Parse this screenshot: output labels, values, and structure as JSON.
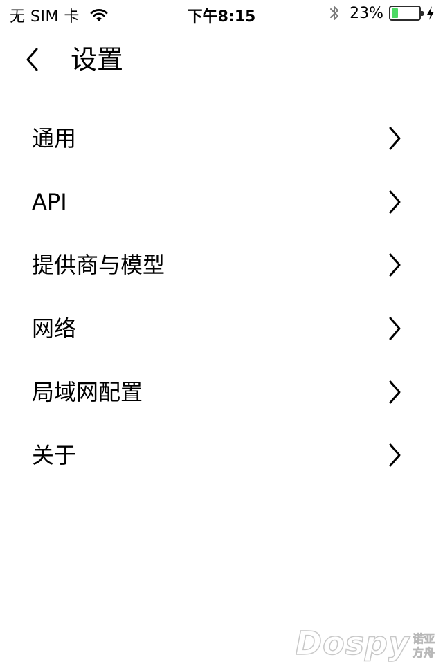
{
  "status_bar": {
    "carrier": "无 SIM 卡",
    "time": "下午8:15",
    "battery_percent": "23%",
    "battery_level": 0.23,
    "battery_color": "#4cd964"
  },
  "header": {
    "back_icon": "chevron-left-icon",
    "title": "设置"
  },
  "menu": {
    "items": [
      {
        "label": "通用"
      },
      {
        "label": "API"
      },
      {
        "label": "提供商与模型"
      },
      {
        "label": "网络"
      },
      {
        "label": "局域网配置"
      },
      {
        "label": "关于"
      }
    ],
    "chevron_icon": "chevron-right-icon"
  },
  "watermark": {
    "logo": "Dospy",
    "cn_top": "诺亚",
    "cn_bottom": "方舟"
  }
}
